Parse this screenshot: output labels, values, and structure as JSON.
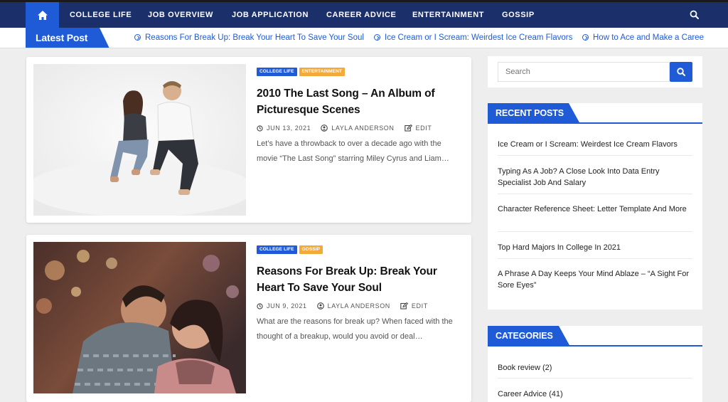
{
  "nav": {
    "items": [
      "COLLEGE LIFE",
      "JOB OVERVIEW",
      "JOB APPLICATION",
      "CAREER ADVICE",
      "ENTERTAINMENT",
      "GOSSIP"
    ]
  },
  "ticker": {
    "label": "Latest Post",
    "items": [
      "Reasons For Break Up: Break Your Heart To Save Your Soul",
      "Ice Cream or I Scream: Weirdest Ice Cream Flavors",
      "How to Ace and Make a Caree"
    ]
  },
  "posts": [
    {
      "categories": [
        "COLLEGE LIFE",
        "ENTERTAINMENT"
      ],
      "title": "2010 The Last Song – An Album of Picturesque Scenes",
      "date": "JUN 13, 2021",
      "author": "LAYLA ANDERSON",
      "edit": "EDIT",
      "excerpt": "Let’s have a throwback to over a decade ago with the movie “The Last Song” starring Miley Cyrus and Liam…"
    },
    {
      "categories": [
        "COLLEGE LIFE",
        "GOSSIP"
      ],
      "title": "Reasons For Break Up: Break Your Heart To Save Your Soul",
      "date": "JUN 9, 2021",
      "author": "LAYLA ANDERSON",
      "edit": "EDIT",
      "excerpt": "What are the reasons for break up? When faced with the thought of a breakup, would you avoid or deal…"
    }
  ],
  "sidebar": {
    "search_placeholder": "Search",
    "recent_title": "RECENT POSTS",
    "recent": [
      "Ice Cream or I Scream: Weirdest Ice Cream Flavors",
      "Typing As A Job? A Close Look Into Data Entry Specialist Job And Salary",
      "Character Reference Sheet: Letter Template And More",
      "Top Hard Majors In College In 2021",
      "A Phrase A Day Keeps Your Mind Ablaze – “A Sight For Sore Eyes”"
    ],
    "categories_title": "CATEGORIES",
    "categories": [
      "Book review (2)",
      "Career Advice (41)"
    ]
  },
  "colors": {
    "nav_bg": "#1b2f6b",
    "accent": "#1f5bd6",
    "badge_blue": "#1f5bd6",
    "badge_orange": "#f4a93b"
  },
  "icons": [
    "home-icon",
    "search-icon",
    "circle-arrow-icon",
    "clock-icon",
    "user-icon",
    "edit-icon"
  ]
}
